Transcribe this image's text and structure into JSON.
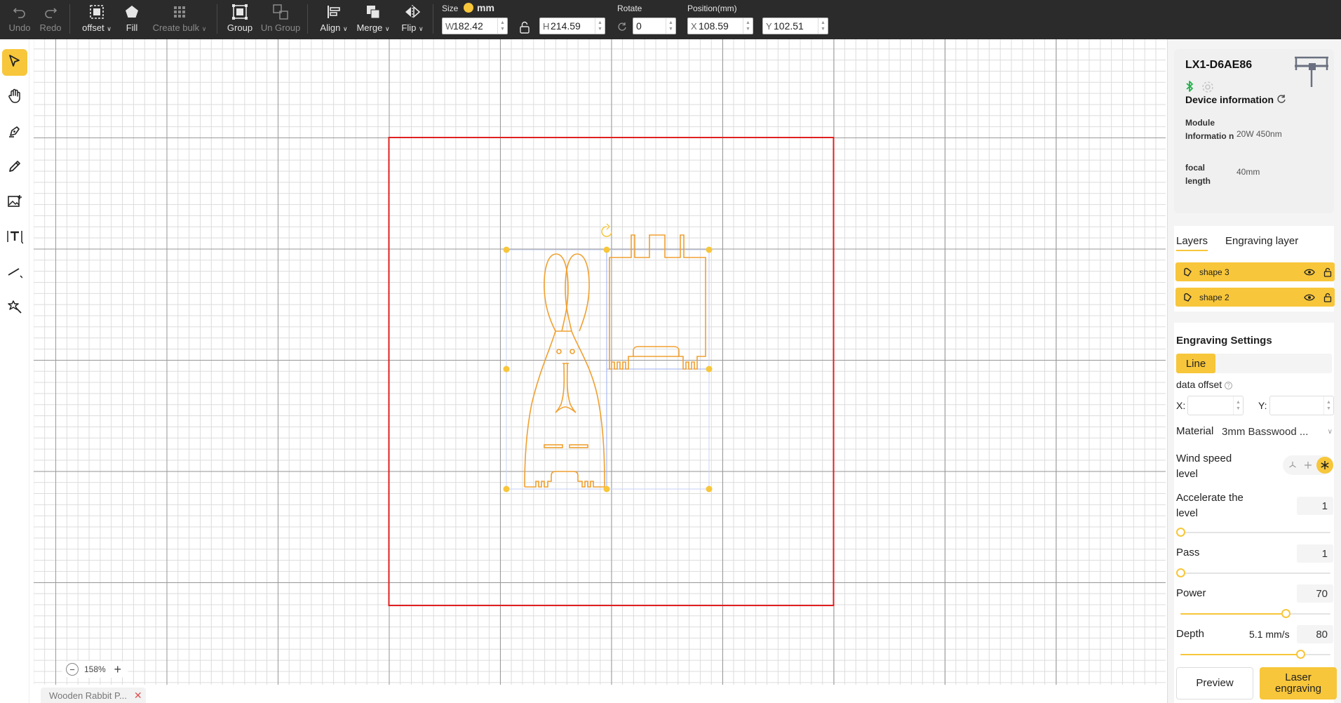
{
  "toolbar": {
    "undo": "Undo",
    "redo": "Redo",
    "offset": "offset",
    "fill": "Fill",
    "create_bulk": "Create bulk",
    "group": "Group",
    "ungroup": "Un Group",
    "align": "Align",
    "merge": "Merge",
    "flip": "Flip",
    "size_label": "Size",
    "unit": "mm",
    "width_prefix": "W",
    "width": "182.42",
    "height_prefix": "H",
    "height": "214.59",
    "rotate_label": "Rotate",
    "rotate": "0",
    "position_label": "Position(mm)",
    "x_prefix": "X",
    "x": "108.59",
    "y_prefix": "Y",
    "y": "102.51"
  },
  "tools": [
    "select-icon",
    "hand-icon",
    "pen-icon",
    "pencil-icon",
    "image-add-icon",
    "text-icon",
    "line-icon",
    "magic-icon"
  ],
  "canvas": {
    "zoom": "158%",
    "file_tab": "Wooden Rabbit P..."
  },
  "device": {
    "name": "LX1-D6AE86",
    "info_title": "Device information",
    "module_label": "Module Informatio n",
    "module_value": "20W 450nm",
    "focal_label": "focal length",
    "focal_value": "40mm"
  },
  "layers": {
    "tab_layers": "Layers",
    "tab_engraving": "Engraving layer",
    "items": [
      {
        "name": "shape 3"
      },
      {
        "name": "shape 2"
      }
    ]
  },
  "engraving": {
    "title": "Engraving Settings",
    "mode": "Line",
    "data_offset": "data offset",
    "x_label": "X:",
    "y_label": "Y:",
    "material_label": "Material",
    "material_value": "3mm Basswood ...",
    "wind_label": "Wind speed level",
    "accel_label": "Accelerate the level",
    "accel_value": "1",
    "accel_fraction": 0.0,
    "pass_label": "Pass",
    "pass_value": "1",
    "pass_fraction": 0.0,
    "power_label": "Power",
    "power_value": "70",
    "power_fraction": 0.7,
    "depth_label": "Depth",
    "speed_text": "5.1 mm/s",
    "depth_value": "80",
    "depth_fraction": 0.8,
    "preview": "Preview",
    "laser": "Laser engraving"
  },
  "colors": {
    "accent": "#f7c63a",
    "shape": "#f0a030",
    "work_area": "#e02020"
  }
}
